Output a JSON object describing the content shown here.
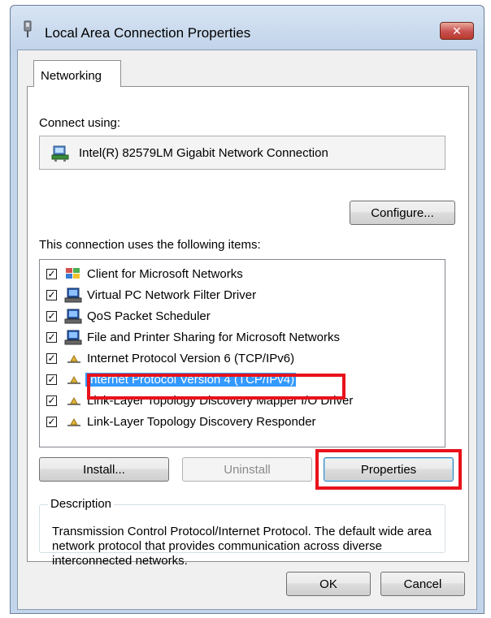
{
  "window": {
    "title": "Local Area Connection Properties",
    "close_glyph": "✕"
  },
  "tabs": [
    {
      "label": "Networking",
      "active": true
    }
  ],
  "connect_using": {
    "label": "Connect using:",
    "adapter": "Intel(R) 82579LM Gigabit Network Connection",
    "icon": "network-adapter-icon"
  },
  "configure_label": "Configure...",
  "items_label": "This connection uses the following items:",
  "items": [
    {
      "label": "Client for Microsoft Networks",
      "checked": true,
      "icon": "network-client-icon"
    },
    {
      "label": "Virtual PC Network Filter Driver",
      "checked": true,
      "icon": "service-icon"
    },
    {
      "label": "QoS Packet Scheduler",
      "checked": true,
      "icon": "service-icon"
    },
    {
      "label": "File and Printer Sharing for Microsoft Networks",
      "checked": true,
      "icon": "service-icon"
    },
    {
      "label": "Internet Protocol Version 6 (TCP/IPv6)",
      "checked": true,
      "icon": "protocol-icon"
    },
    {
      "label": "Internet Protocol Version 4 (TCP/IPv4)",
      "checked": true,
      "selected": true,
      "icon": "protocol-icon"
    },
    {
      "label": "Link-Layer Topology Discovery Mapper I/O Driver",
      "checked": true,
      "icon": "protocol-icon"
    },
    {
      "label": "Link-Layer Topology Discovery Responder",
      "checked": true,
      "icon": "protocol-icon"
    }
  ],
  "buttons": {
    "install": "Install...",
    "uninstall": "Uninstall",
    "properties": "Properties",
    "ok": "OK",
    "cancel": "Cancel"
  },
  "description": {
    "legend": "Description",
    "text": "Transmission Control Protocol/Internet Protocol. The default wide area network protocol that provides communication across diverse interconnected networks."
  },
  "colors": {
    "annotation_red": "#e8121b",
    "selection_blue": "#3399ff"
  }
}
